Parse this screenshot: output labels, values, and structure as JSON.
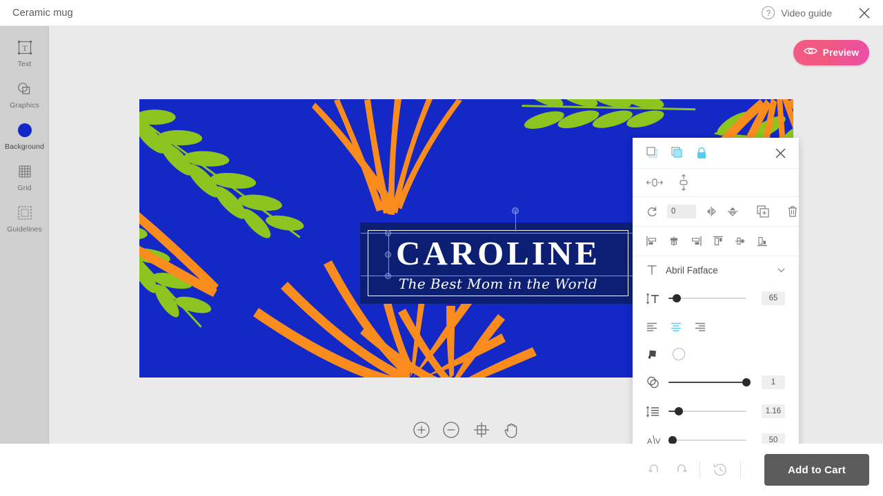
{
  "topbar": {
    "title": "Ceramic mug",
    "video_guide_label": "Video guide",
    "help_icon": "question-mark-icon",
    "close_icon": "close-icon"
  },
  "sidebar": {
    "items": [
      {
        "label": "Text",
        "icon": "text-box-icon",
        "active": false
      },
      {
        "label": "Graphics",
        "icon": "shapes-icon",
        "active": false
      },
      {
        "label": "Background",
        "icon": "filled-circle-icon",
        "active": true
      },
      {
        "label": "Grid",
        "icon": "grid-icon",
        "active": false
      },
      {
        "label": "Guidelines",
        "icon": "guidelines-frame-icon",
        "active": false
      }
    ]
  },
  "stage": {
    "preview_label": "Preview",
    "preview_icon": "eye-icon",
    "preview_color": "#ef5a8c",
    "zoom_tools": [
      {
        "name": "zoom-in-icon",
        "label": "Zoom in"
      },
      {
        "name": "zoom-out-icon",
        "label": "Zoom out"
      },
      {
        "name": "fit-to-screen-icon",
        "label": "Fit to screen"
      },
      {
        "name": "pan-hand-icon",
        "label": "Pan"
      }
    ]
  },
  "design": {
    "background_color": "#1328c4",
    "leaf_color": "#8dc420",
    "frond_color": "#fa8c1e",
    "banner_color": "#0d1f73",
    "headline": "CAROLINE",
    "subline": "The Best Mom in the World"
  },
  "panel": {
    "close_icon": "close-icon",
    "layer_tools": [
      {
        "name": "bring-to-front-icon",
        "active": false
      },
      {
        "name": "send-to-back-icon",
        "active": true
      },
      {
        "name": "lock-icon",
        "active": true
      }
    ],
    "fit_tools": [
      {
        "name": "fit-width-icon"
      },
      {
        "name": "fit-height-icon"
      }
    ],
    "transform": {
      "rotate_icon": "rotate-icon",
      "rotate_value": "0",
      "flip_horizontal_icon": "flip-horizontal-icon",
      "flip_vertical_icon": "flip-vertical-icon",
      "duplicate_icon": "duplicate-icon",
      "delete_icon": "trash-icon"
    },
    "align_tools": [
      {
        "name": "align-left-icon"
      },
      {
        "name": "align-center-horizontal-icon"
      },
      {
        "name": "align-right-icon"
      },
      {
        "name": "align-top-icon"
      },
      {
        "name": "align-middle-vertical-icon"
      },
      {
        "name": "align-bottom-icon"
      }
    ],
    "font": {
      "icon": "font-family-icon",
      "name": "Abril Fatface",
      "caret_icon": "chevron-down-icon"
    },
    "font_size": {
      "icon": "font-size-icon",
      "value": "65",
      "percent": 11
    },
    "text_align": [
      {
        "name": "text-align-left-icon",
        "active": false
      },
      {
        "name": "text-align-center-icon",
        "active": true
      },
      {
        "name": "text-align-right-icon",
        "active": false
      }
    ],
    "fill": {
      "bucket_icon": "paint-bucket-icon",
      "swatch_icon": "color-swatch-icon",
      "swatch_color": "#ffffff"
    },
    "opacity": {
      "icon": "opacity-icon",
      "value": "1",
      "percent": 100
    },
    "line_height": {
      "icon": "line-height-icon",
      "value": "1.16",
      "percent": 13
    },
    "letter_spacing": {
      "icon": "letter-spacing-icon",
      "value": "50",
      "percent": 4
    },
    "accent_color": "#4ecdf5"
  },
  "bottombar": {
    "undo_icon": "undo-icon",
    "redo_icon": "redo-icon",
    "history_icon": "history-clock-icon",
    "add_to_cart_label": "Add to Cart"
  }
}
